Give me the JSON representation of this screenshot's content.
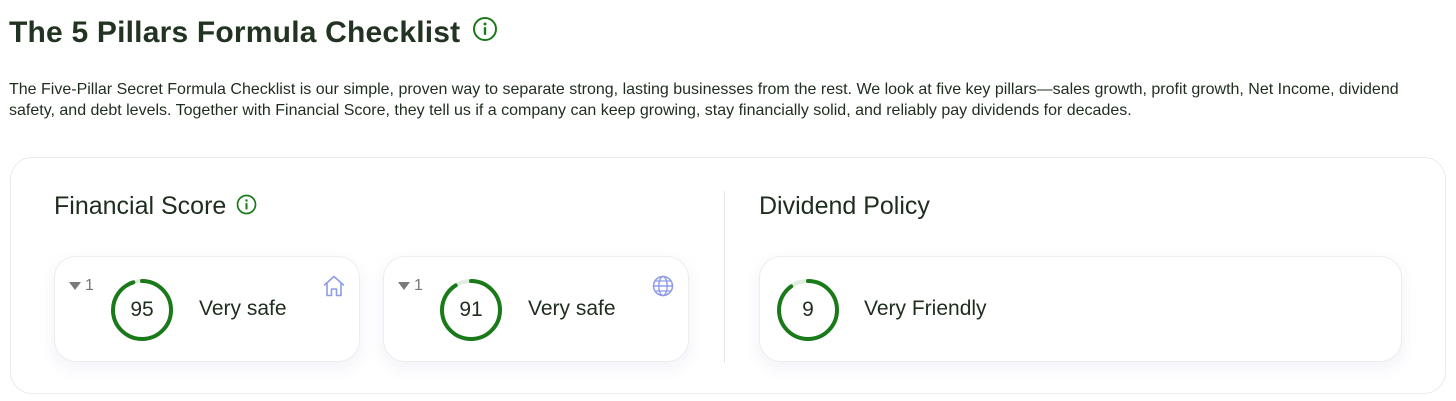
{
  "header": {
    "title": "The 5 Pillars Formula Checklist",
    "info_icon": "info-icon",
    "intro_text": "The Five-Pillar Secret Formula Checklist is our simple, proven way to separate strong, lasting businesses from the rest. We look at five key pillars—sales growth, profit growth, Net Income, dividend safety, and debt levels. Together with Financial Score, they tell us if a company can keep growing, stay financially solid, and reliably pay dividends for decades."
  },
  "financial_score": {
    "title": "Financial Score",
    "info_icon": "info-icon",
    "cards": [
      {
        "delta": "1",
        "delta_icon": "triangle-down-icon",
        "score": "95",
        "label": "Very safe",
        "corner_icon": "home-icon"
      },
      {
        "delta": "1",
        "delta_icon": "triangle-down-icon",
        "score": "91",
        "label": "Very safe",
        "corner_icon": "globe-icon"
      }
    ]
  },
  "dividend_policy": {
    "title": "Dividend Policy",
    "card": {
      "score": "9",
      "label": "Very Friendly"
    }
  },
  "colors": {
    "accent_green": "#1a7a1a",
    "gauge_track": "#dfeedf",
    "icon_lavender": "#8f9be8",
    "text": "#1f2d1f"
  }
}
